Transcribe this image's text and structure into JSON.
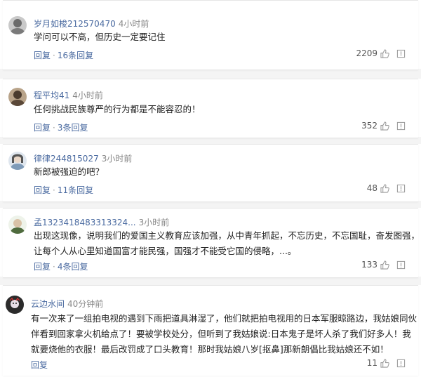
{
  "comments": [
    {
      "username": "岁月如梭212570470",
      "time": "4小时前",
      "lines": [
        "学问可以不高，但历史一定要记住"
      ],
      "reply_label": "回复",
      "sep": "·",
      "replies_label": "16条回复",
      "likes": "2209"
    },
    {
      "username": "程平均41",
      "time": "4小时前",
      "lines": [
        "任何挑战民族尊严的行为都是不能容忍的！"
      ],
      "reply_label": "回复",
      "sep": "·",
      "replies_label": "3条回复",
      "likes": "352"
    },
    {
      "username": "律律244815027",
      "time": "3小时前",
      "lines": [
        "新郎被强迫的吧？"
      ],
      "reply_label": "回复",
      "sep": "·",
      "replies_label": "11条回复",
      "likes": "48"
    },
    {
      "username": "孟1323418483313324...",
      "time": "3小时前",
      "lines": [
        "出现这现像，说明我们的爱国主义教育应该加强，从中青年抓起，不忘历史，不忘国耻，奋发图强，",
        "让每个人从心里知道国富才能民强，国强才不能受它国的侵略，...。"
      ],
      "reply_label": "回复",
      "sep": "·",
      "replies_label": "4条回复",
      "likes": "133"
    },
    {
      "username": "云边水间",
      "time": "40分钟前",
      "lines": [
        "有一次来了一组拍电视的遇到下雨把道具淋湿了，他们就把拍电视用的日本军服晾路边，我姑娘同伙",
        "伴看到回家拿火机给点了！要被学校处分，但听到了我姑娘说:日本鬼子是坏人杀了我们好多人！我",
        "就要烧他的衣服！最后改罚成了口头教育！那时我姑娘八岁[抠鼻]那新朗倡比我姑娘还不如！"
      ],
      "reply_label": "回复",
      "likes": "11"
    }
  ],
  "icons": {
    "like": "thumbs-up-icon",
    "report": "report-flag-icon"
  },
  "colors": {
    "username": "#4a6aa0",
    "text": "#222222",
    "muted": "#888888"
  }
}
